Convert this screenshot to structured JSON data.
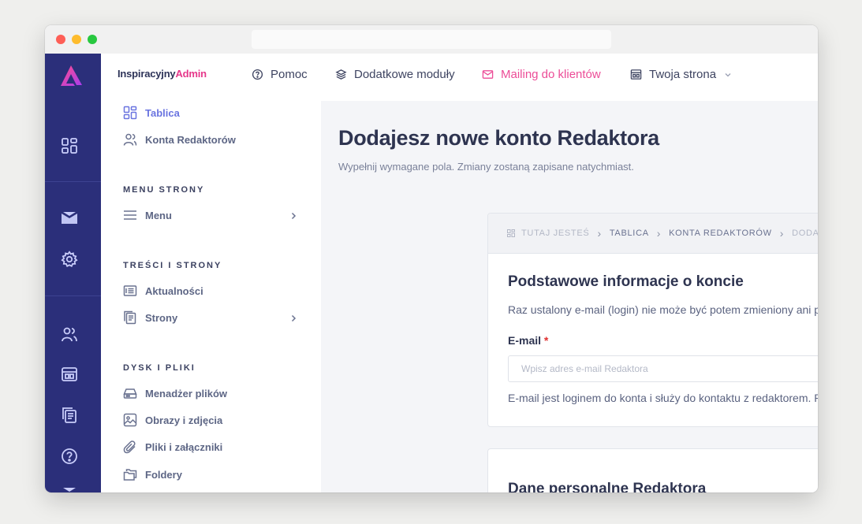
{
  "brand": {
    "name_part1": "Inspiracyjny",
    "name_part2": "Admin",
    "accent_color": "#e6388b"
  },
  "rail": {
    "background": "#2b2f7a",
    "icons": [
      "dashboard-icon",
      "mail-icon",
      "settings-icon",
      "users-icon",
      "layout-icon",
      "pages-icon",
      "help-icon"
    ]
  },
  "topnav": [
    {
      "label": "Pomoc",
      "icon": "help-circle-icon"
    },
    {
      "label": "Dodatkowe moduły",
      "icon": "layers-icon"
    },
    {
      "label": "Mailing do klientów",
      "icon": "mailbox-icon",
      "color": "#ec4c97"
    },
    {
      "label": "Twoja strona",
      "icon": "layout-icon",
      "dropdown": "chevron-down-icon"
    }
  ],
  "sidebar": {
    "items_top": [
      {
        "label": "Tablica",
        "icon": "dashboard-icon",
        "active": true
      },
      {
        "label": "Konta Redaktorów",
        "icon": "users-icon"
      }
    ],
    "sections": [
      {
        "heading": "MENU STRONY",
        "items": [
          {
            "label": "Menu",
            "icon": "menu-icon",
            "has_submenu": true
          }
        ]
      },
      {
        "heading": "TREŚCI I STRONY",
        "items": [
          {
            "label": "Aktualności",
            "icon": "news-icon"
          },
          {
            "label": "Strony",
            "icon": "pages-icon",
            "has_submenu": true
          }
        ]
      },
      {
        "heading": "DYSK I PLIKI",
        "items": [
          {
            "label": "Menadżer plików",
            "icon": "drive-icon"
          },
          {
            "label": "Obrazy i zdjęcia",
            "icon": "image-icon"
          },
          {
            "label": "Pliki i załączniki",
            "icon": "paperclip-icon"
          },
          {
            "label": "Foldery",
            "icon": "folders-icon"
          }
        ]
      }
    ]
  },
  "page": {
    "title": "Dodajesz nowe konto Redaktora",
    "subtitle": "Wypełnij wymagane pola. Zmiany zostaną zapisane natychmiast."
  },
  "breadcrumb": {
    "prefix": "TUTAJ JESTEŚ",
    "items": [
      "TABLICA",
      "KONTA REDAKTORÓW",
      "DODA"
    ]
  },
  "form": {
    "section1_title": "Podstawowe informacje o koncie",
    "section1_desc": "Raz ustalony e-mail (login) nie może być potem zmieniony ani p",
    "email_label": "E-mail",
    "required_mark": "*",
    "email_placeholder": "Wpisz adres e-mail Redaktora",
    "email_value": "",
    "email_help": "E-mail jest loginem do konta i służy do kontaktu z redaktorem. P",
    "section2_title": "Dane personalne Redaktora"
  }
}
